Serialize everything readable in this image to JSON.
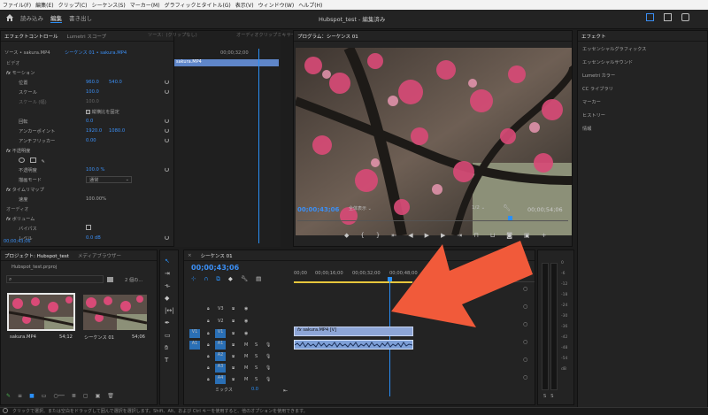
{
  "menu": [
    "ファイル(F)",
    "編集(E)",
    "クリップ(C)",
    "シーケンス(S)",
    "マーカー(M)",
    "グラフィックとタイトル(G)",
    "表示(V)",
    "ウィンドウ(W)",
    "ヘルプ(H)"
  ],
  "workspace": {
    "tabs": [
      "読み込み",
      "編集",
      "書き出し"
    ],
    "active_tab": "編集",
    "title": "Hubspot_test - 編集済み"
  },
  "effect_controls": {
    "tabs": [
      "エフェクトコントロール",
      "Lumetri スコープ",
      "ソース：(クリップなし)",
      "オーディオクリップミキサー："
    ],
    "source_label": "ソース • sakura.MP4",
    "sequence_label": "シーケンス 01 • sakura.MP4",
    "section_video": "ビデオ",
    "motion": "モーション",
    "position_label": "位置",
    "position_x": "960.0",
    "position_y": "540.0",
    "scale_label": "スケール",
    "scale_value": "100.0",
    "scale_width_label": "スケール (幅)",
    "scale_width_value": "100.0",
    "uniform_scale": "縦横比を固定",
    "rotation_label": "回転",
    "rotation_value": "0.0",
    "anchor_label": "アンカーポイント",
    "anchor_x": "1920.0",
    "anchor_y": "1080.0",
    "flicker_label": "アンチフリッカー",
    "flicker_value": "0.00",
    "opacity": "不透明度",
    "opacity_label": "不透明度",
    "opacity_value": "100.0 %",
    "blend_label": "描画モード",
    "blend_value": "通常",
    "time_remap": "タイムリマップ",
    "speed_label": "速度",
    "speed_value": "100.00%",
    "section_audio": "オーディオ",
    "volume": "ボリューム",
    "bypass_label": "バイパス",
    "level_label": "レベル",
    "level_value": "0.0 dB",
    "timecode": "00;00;43;06",
    "ruler_time": "00;00;32;00",
    "clip_name": "sakura.MP4"
  },
  "program": {
    "title": "プログラム：シーケンス 01",
    "timecode": "00;00;43;06",
    "fit": "全体表示",
    "resolution": "1/2",
    "duration": "00;00;54;06"
  },
  "effects_panel": {
    "title": "エフェクト",
    "items": [
      "エッセンシャルグラフィックス",
      "エッセンシャルサウンド",
      "Lumetri カラー",
      "CC ライブラリ",
      "マーカー",
      "ヒストリー",
      "情報"
    ]
  },
  "project": {
    "tabs": [
      "プロジェクト: Hubspot_test",
      "メディアブラウザー"
    ],
    "file": "Hubspot_test.prproj",
    "count": "2 個の...",
    "items": [
      {
        "name": "sakura.MP4",
        "duration": "54;12"
      },
      {
        "name": "シーケンス 01",
        "duration": "54;06"
      }
    ]
  },
  "timeline": {
    "tab": "シーケンス 01",
    "timecode": "00;00;43;06",
    "ruler": [
      "00;00",
      "00;00;16;00",
      "00;00;32;00",
      "00;00;48;00"
    ],
    "video_tracks": [
      "V3",
      "V2",
      "V1"
    ],
    "audio_tracks": [
      "A1",
      "A2",
      "A3",
      "A4"
    ],
    "source_v": "V1",
    "source_a": "A1",
    "mix_label": "ミックス",
    "mix_value": "0.0",
    "video_clip": "sakura.MP4 [V]"
  },
  "meter": {
    "labels": [
      "0",
      "-6",
      "-12",
      "-18",
      "-24",
      "-30",
      "-36",
      "-42",
      "-48",
      "-54",
      "dB"
    ]
  },
  "status_bar": "クリックで選択、または空白をドラッグして囲んで選択を選択します。Shift、Alt、および Ctrl キーを使用すると、他のオプションを使用できます。",
  "colors": {
    "accent": "#2a8ff7",
    "arrow": "#f15a3a",
    "clip_video": "#8da5d6",
    "clip_audio": "#7ea0d8"
  }
}
